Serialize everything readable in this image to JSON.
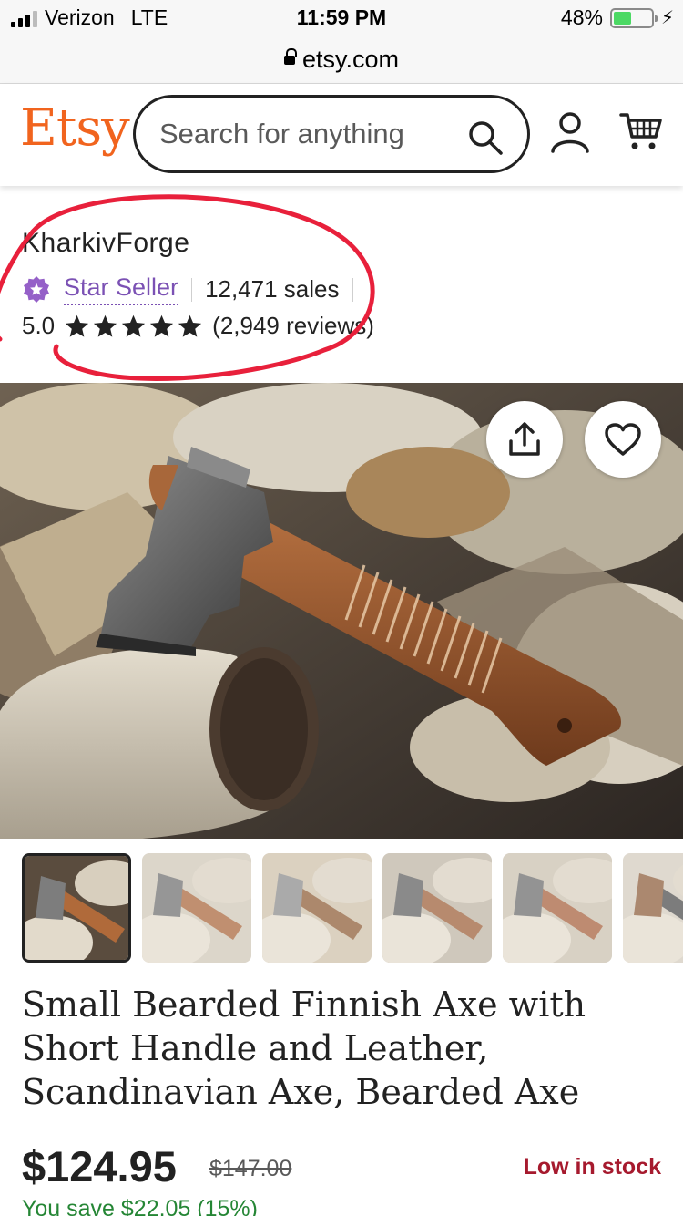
{
  "status_bar": {
    "carrier": "Verizon",
    "network": "LTE",
    "time": "11:59 PM",
    "battery_percent": "48%",
    "battery_level": 0.48,
    "url": "etsy.com"
  },
  "header": {
    "logo": "Etsy",
    "search_placeholder": "Search for anything",
    "brand_color": "#f1641e"
  },
  "seller": {
    "shop_name": "KharkivForge",
    "badge_label": "Star Seller",
    "sales": "12,471 sales",
    "rating": "5.0",
    "stars": 5,
    "reviews": "(2,949 reviews)",
    "annotation_color": "#e8203b"
  },
  "product": {
    "title": "Small Bearded Finnish Axe with Short Handle and Leather, Scandinavian Axe, Bearded Axe",
    "price": "$124.95",
    "original_price": "$147.00",
    "stock_status": "Low in stock",
    "savings": "You save $22.05 (15%)",
    "thumbnail_count": 6,
    "selected_thumbnail": 1
  },
  "icons": {
    "search": "search-icon",
    "account": "account-icon",
    "cart": "cart-icon",
    "share": "share-icon",
    "favorite": "heart-icon",
    "badge": "star-seller-icon"
  }
}
